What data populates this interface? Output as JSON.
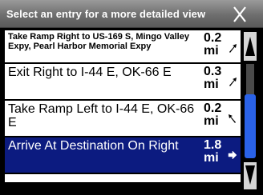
{
  "header": {
    "title": "Select an entry for a more detailed view"
  },
  "entries": [
    {
      "text": "Take Ramp Right to US-169 S, Mingo Valley Expy, Pearl Harbor Memorial Expy",
      "dist_value": "0.2",
      "dist_unit": "mi",
      "arrow": "turn-right-arrow-icon"
    },
    {
      "text": "Exit Right to I-44 E, OK-66 E",
      "dist_value": "0.3",
      "dist_unit": "mi",
      "arrow": "turn-right-arrow-icon"
    },
    {
      "text": "Take Ramp Left to I-44 E, OK-66 E",
      "dist_value": "0.2",
      "dist_unit": "mi",
      "arrow": "turn-left-arrow-icon"
    },
    {
      "text": "Arrive At Destination On Right",
      "dist_value": "1.8",
      "dist_unit": "mi",
      "arrow": "destination-arrow-icon",
      "selected": true
    }
  ],
  "colors": {
    "selected": "#0c1b80",
    "scroll_thumb": "#2a62e8",
    "close_x": "#ffffff"
  }
}
